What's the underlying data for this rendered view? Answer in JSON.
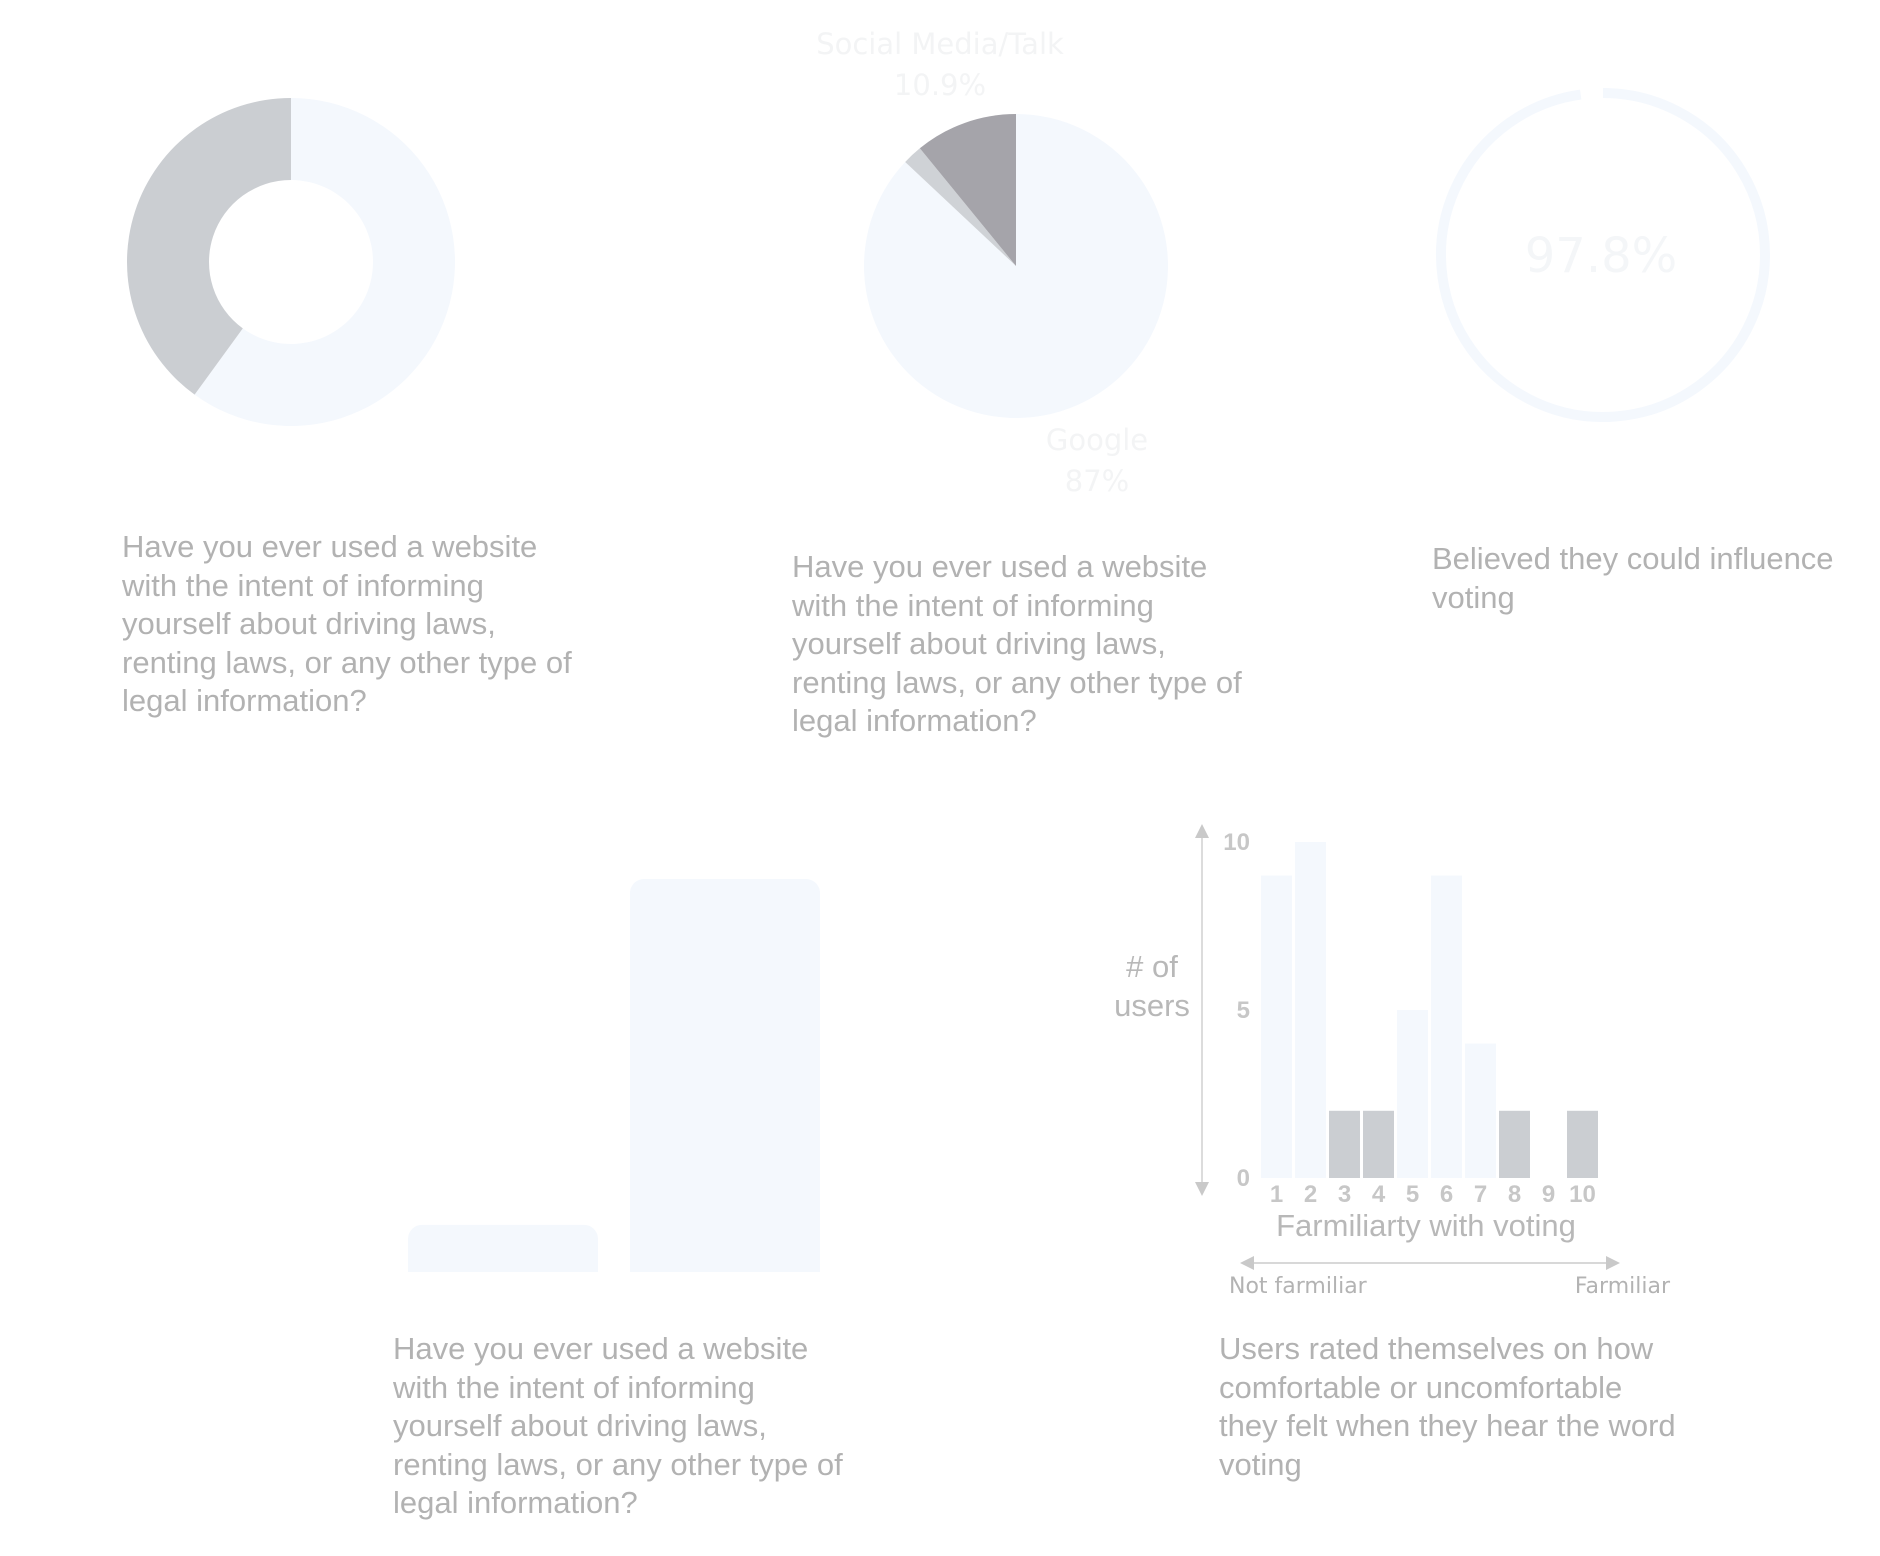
{
  "colors": {
    "pale_blue": "#f4f8fd",
    "gray": "#cbced2",
    "dark_gray": "#a5a4aa",
    "mid_gray": "#cfd2d6",
    "text": "#b2b2b2"
  },
  "captions": {
    "donut": "Have you ever used a website with the intent of informing yourself about driving laws, renting laws, or any other type of legal information?",
    "pie": "Have you ever used a website with the intent of informing yourself about driving laws, renting laws, or any other type of legal information?",
    "gauge": "Believed they could influence voting",
    "bars": "Have you ever used a website with the intent of informing yourself about driving laws, renting laws, or any other type of legal information?",
    "histogram": "Users rated themselves on how comfortable or uncomfortable they felt when they hear the word voting"
  },
  "chart_data": [
    {
      "type": "pie",
      "style": "donut",
      "slices": [
        {
          "value": 60,
          "color": "#f4f8fd"
        },
        {
          "value": 40,
          "color": "#cbced2"
        }
      ]
    },
    {
      "type": "pie",
      "slices": [
        {
          "label": "Google",
          "value_label": "87%",
          "value": 87,
          "color": "#f4f8fd"
        },
        {
          "label": "",
          "value_label": "",
          "value": 2.1,
          "color": "#cfd2d6"
        },
        {
          "label": "Social Media/Talk",
          "value_label": "10.9%",
          "value": 10.9,
          "color": "#a5a4aa"
        }
      ]
    },
    {
      "type": "pie",
      "style": "gauge",
      "value": 97.8,
      "value_label": "97.8%",
      "color": "#f4f8fd"
    },
    {
      "type": "bar",
      "categories": [
        "",
        ""
      ],
      "values": [
        12,
        100
      ],
      "color": "#f4f8fd"
    },
    {
      "type": "bar",
      "xlabel": "Farmiliarty with voting",
      "ylabel": "# of users",
      "categories": [
        "1",
        "2",
        "3",
        "4",
        "5",
        "6",
        "7",
        "8",
        "9",
        "10"
      ],
      "values": [
        9,
        10,
        2,
        2,
        5,
        9,
        4,
        2,
        0,
        2
      ],
      "colors": [
        "#f4f8fd",
        "#f4f8fd",
        "#cbced2",
        "#cbced2",
        "#f4f8fd",
        "#f4f8fd",
        "#f4f8fd",
        "#cbced2",
        "#f4f8fd",
        "#cbced2"
      ],
      "ylim": [
        0,
        10
      ],
      "yticks": [
        "0",
        "5",
        "10"
      ],
      "scale_labels": {
        "low": "Not farmiliar",
        "high": "Farmiliar"
      }
    }
  ]
}
